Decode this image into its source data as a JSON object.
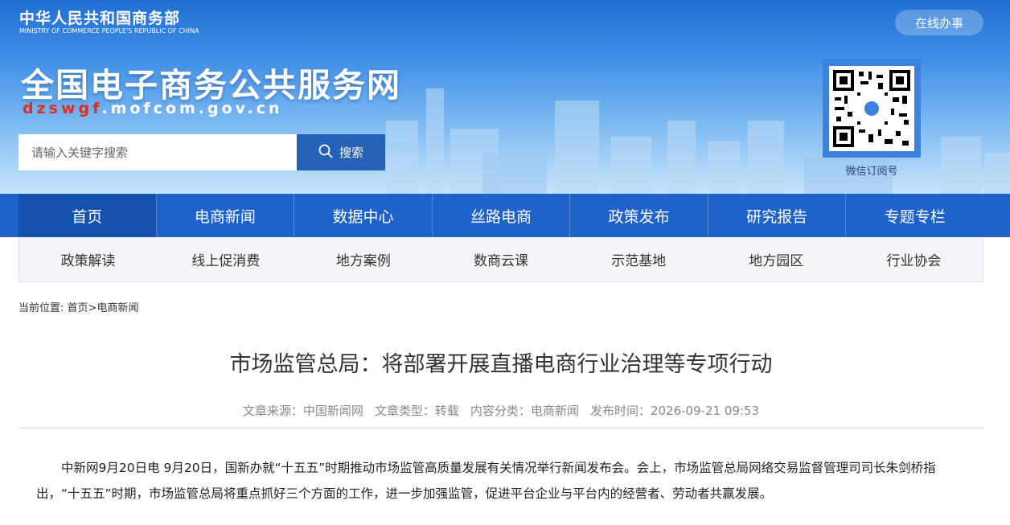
{
  "header": {
    "ministry_cn": "中华人民共和国商务部",
    "ministry_en": "MINISTRY OF COMMERCE PEOPLE'S REPUBLIC OF CHINA",
    "online_service": "在线办事",
    "site_title": "全国电子商务公共服务网",
    "domain_highlight": "dzswgf",
    "domain_rest": ".mofcom.gov.cn",
    "search_placeholder": "请输入关键字搜索",
    "search_button": "搜索",
    "qr_caption": "微信订阅号"
  },
  "colors": {
    "primary_blue": "#1f62c9",
    "active_nav": "#1552ad",
    "domain_red": "#e02d1f"
  },
  "main_nav": [
    {
      "label": "首页",
      "active": true
    },
    {
      "label": "电商新闻"
    },
    {
      "label": "数据中心"
    },
    {
      "label": "丝路电商"
    },
    {
      "label": "政策发布"
    },
    {
      "label": "研究报告"
    },
    {
      "label": "专题专栏"
    }
  ],
  "sub_nav": [
    {
      "label": "政策解读"
    },
    {
      "label": "线上促消费"
    },
    {
      "label": "地方案例"
    },
    {
      "label": "数商云课"
    },
    {
      "label": "示范基地"
    },
    {
      "label": "地方园区"
    },
    {
      "label": "行业协会"
    }
  ],
  "breadcrumb": {
    "prefix": "当前位置: ",
    "home": "首页",
    "sep": ">",
    "current": "电商新闻"
  },
  "article": {
    "title": "市场监管总局：将部署开展直播电商行业治理等专项行动",
    "meta": {
      "source_label": "文章来源：",
      "source": "中国新闻网",
      "type_label": "文章类型：",
      "type": "转载",
      "category_label": "内容分类：",
      "category": "电商新闻",
      "time_label": "发布时间：",
      "time": "2026-09-21 09:53"
    },
    "paragraph": "中新网9月20日电 9月20日，国新办就“十五五”时期推动市场监管高质量发展有关情况举行新闻发布会。会上，市场监管总局网络交易监督管理司司长朱剑桥指出，“十五五”时期，市场监管总局将重点抓好三个方面的工作，进一步加强监管，促进平台企业与平台内的经营者、劳动者共赢发展。"
  }
}
